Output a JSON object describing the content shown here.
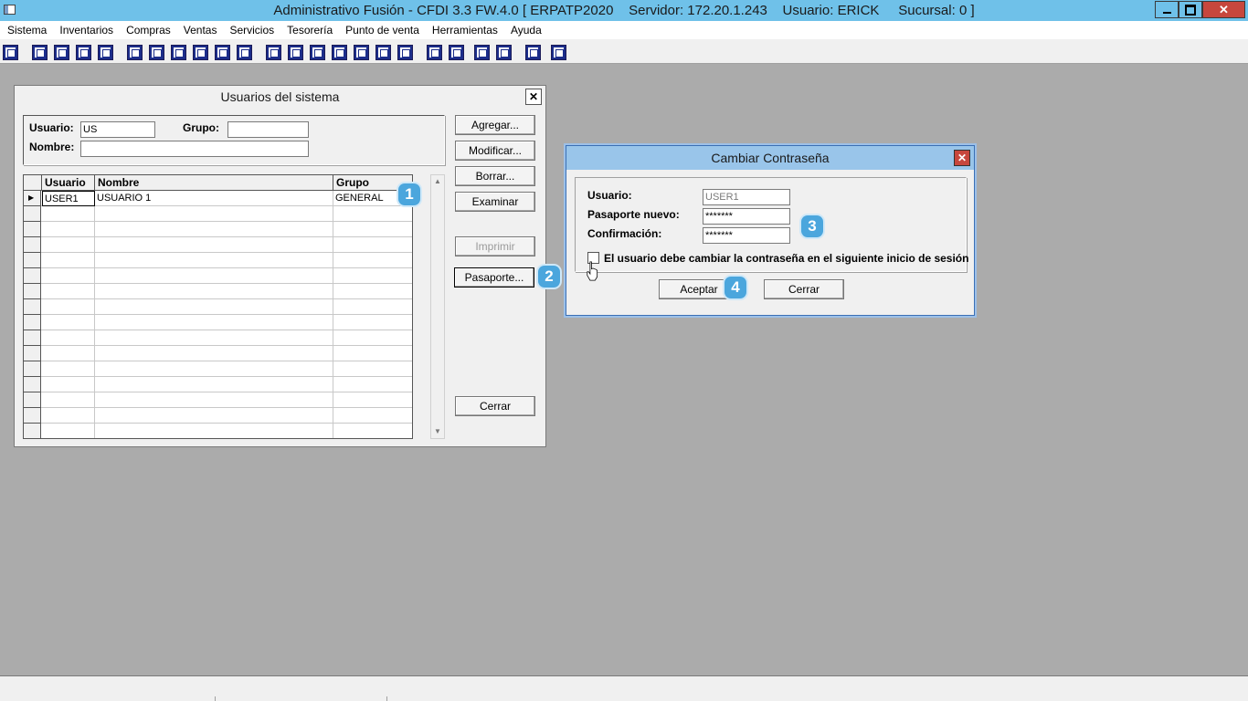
{
  "app": {
    "title": "Administrativo Fusión - CFDI 3.3 FW.4.0 [ ERPATP2020    Servidor: 172.20.1.243    Usuario: ERICK     Sucursal: 0 ]"
  },
  "menu": [
    "Sistema",
    "Inventarios",
    "Compras",
    "Ventas",
    "Servicios",
    "Tesorería",
    "Punto de venta",
    "Herramientas",
    "Ayuda"
  ],
  "usuarios_window": {
    "title": "Usuarios del sistema",
    "filters": {
      "usuario_label": "Usuario:",
      "usuario_value": "US",
      "grupo_label": "Grupo:",
      "grupo_value": "",
      "nombre_label": "Nombre:",
      "nombre_value": ""
    },
    "columns": [
      "Usuario",
      "Nombre",
      "Grupo"
    ],
    "rows": [
      {
        "usuario": "USER1",
        "nombre": "USUARIO 1",
        "grupo": "GENERAL"
      }
    ],
    "buttons": {
      "agregar": "Agregar...",
      "modificar": "Modificar...",
      "borrar": "Borrar...",
      "examinar": "Examinar",
      "imprimir": "Imprimir",
      "pasaporte": "Pasaporte...",
      "cerrar": "Cerrar"
    }
  },
  "password_dialog": {
    "title": "Cambiar Contraseña",
    "usuario_label": "Usuario:",
    "usuario_value": "USER1",
    "nuevo_label": "Pasaporte nuevo:",
    "nuevo_value": "*******",
    "confirm_label": "Confirmación:",
    "confirm_value": "*******",
    "checkbox_label": "El usuario debe cambiar la contraseña en el siguiente inicio de sesión",
    "checkbox_checked": false,
    "aceptar": "Aceptar",
    "cerrar": "Cerrar"
  },
  "badges": [
    "1",
    "2",
    "3",
    "4"
  ],
  "colors": {
    "titlebar": "#6fc1e9",
    "dialog_titlebar": "#99c5ea",
    "close_red": "#c7473d",
    "workspace": "#ababab",
    "badge": "#4ba6dd"
  }
}
